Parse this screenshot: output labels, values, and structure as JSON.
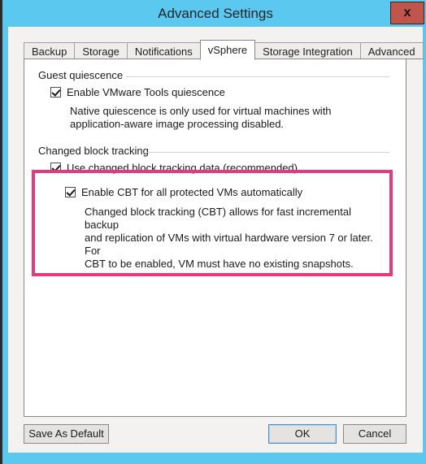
{
  "window": {
    "title": "Advanced Settings",
    "close_label": "x",
    "frame_color": "#5bc8ef",
    "titlebar_color": "#5bc8ef"
  },
  "tabs": [
    {
      "label": "Backup",
      "active": false
    },
    {
      "label": "Storage",
      "active": false
    },
    {
      "label": "Notifications",
      "active": false
    },
    {
      "label": "vSphere",
      "active": true
    },
    {
      "label": "Storage Integration",
      "active": false
    },
    {
      "label": "Advanced",
      "active": false
    }
  ],
  "groups": {
    "guest_quiescence": {
      "label": "Guest quiescence",
      "checkbox": {
        "label": "Enable VMware Tools quiescence",
        "checked": true
      },
      "help_line_1": "Native quiescence is only used for virtual machines with",
      "help_line_2": "application-aware image processing disabled."
    },
    "changed_block_tracking": {
      "label": "Changed block tracking",
      "highlight_color": "#e8397e",
      "checkbox_primary": {
        "label": "Use changed block tracking data (recommended)",
        "checked": true
      },
      "checkbox_secondary": {
        "label": "Enable CBT for all protected VMs automatically",
        "checked": true
      },
      "help_line_1": "Changed block tracking (CBT) allows for fast incremental backup",
      "help_line_2": "and replication of VMs with virtual hardware version 7 or later. For",
      "help_line_3": "CBT to be enabled, VM must have no existing snapshots."
    }
  },
  "footer": {
    "save_as_default": "Save As Default",
    "ok": "OK",
    "cancel": "Cancel"
  }
}
